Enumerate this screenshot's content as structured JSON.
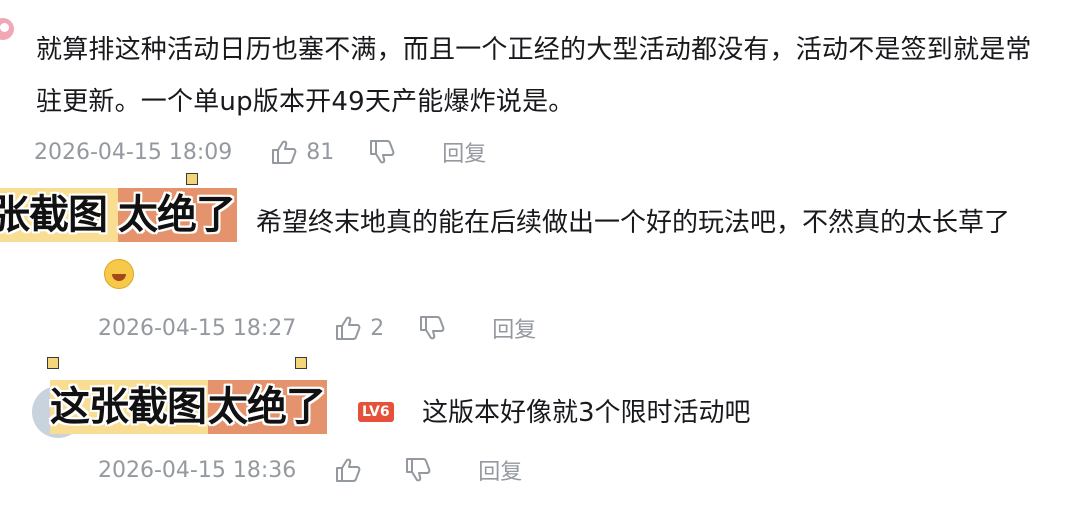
{
  "comment": {
    "text": "就算排这种活动日历也塞不满，而且一个正经的大型活动都没有，活动不是签到就是常驻更新。一个单up版本开49天产能爆炸说是。",
    "time": "2026-04-15 18:09",
    "likes": "81",
    "reply_label": "回复"
  },
  "replies": [
    {
      "text": "希望终末地真的能在后续做出一个好的玩法吧，不然真的太长草了",
      "emoji": "laugh-cry-emoji",
      "time": "2026-04-15 18:27",
      "likes": "2",
      "reply_label": "回复"
    },
    {
      "level": "LV6",
      "text": "这版本好像就3个限时活动吧",
      "time": "2026-04-15 18:36",
      "likes": "",
      "reply_label": "回复"
    }
  ],
  "stickers": [
    {
      "part_a": "张截图",
      "part_b": "太绝了"
    },
    {
      "part_a": "这张截图",
      "part_b": "太绝了"
    }
  ],
  "colors": {
    "text": "#18191c",
    "meta": "#9499a0",
    "sticker_yellow": "#f8dd93",
    "sticker_orange": "#e4936d",
    "level_badge": "#e6513a"
  }
}
